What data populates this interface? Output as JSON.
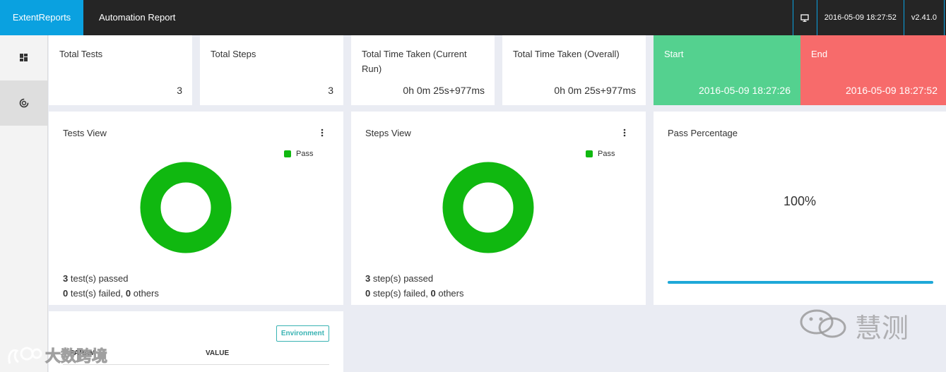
{
  "topbar": {
    "brand": "ExtentReports",
    "title": "Automation Report",
    "datetime": "2016-05-09 18:27:52",
    "version": "v2.41.0",
    "icon": "monitor-icon"
  },
  "sidebar": {
    "items": [
      {
        "icon": "dashboard-icon",
        "active": false
      },
      {
        "icon": "spinner-icon",
        "active": true
      }
    ]
  },
  "stats": {
    "total_tests": {
      "label": "Total Tests",
      "value": "3"
    },
    "total_steps": {
      "label": "Total Steps",
      "value": "3"
    },
    "time_current": {
      "label": "Total Time Taken (Current Run)",
      "value": "0h 0m 25s+977ms"
    },
    "time_overall": {
      "label": "Total Time Taken (Overall)",
      "value": "0h 0m 25s+977ms"
    },
    "start": {
      "label": "Start",
      "value": "2016-05-09 18:27:26"
    },
    "end": {
      "label": "End",
      "value": "2016-05-09 18:27:52"
    }
  },
  "tests_view": {
    "title": "Tests View",
    "legend": "Pass",
    "passed_count": "3",
    "passed_text": " test(s) passed",
    "failed_count": "0",
    "failed_text": " test(s) failed, ",
    "others_count": "0",
    "others_text": " others"
  },
  "steps_view": {
    "title": "Steps View",
    "legend": "Pass",
    "passed_count": "3",
    "passed_text": " step(s) passed",
    "failed_count": "0",
    "failed_text": " step(s) failed, ",
    "others_count": "0",
    "others_text": " others"
  },
  "pass_percentage": {
    "title": "Pass Percentage",
    "value_text": "100%",
    "fill_fraction": 1.0
  },
  "environment": {
    "button": "Environment",
    "col_param": "PARAM",
    "col_value": "VALUE"
  },
  "watermarks": {
    "left": "大数跨境",
    "right": "慧测"
  },
  "colors": {
    "brand": "#0aa1e0",
    "topbar": "#252525",
    "pass": "#10b810",
    "start": "#54d18f",
    "end": "#f76b6b",
    "progress": "#1fa8d8",
    "env": "#39b3b3"
  }
}
